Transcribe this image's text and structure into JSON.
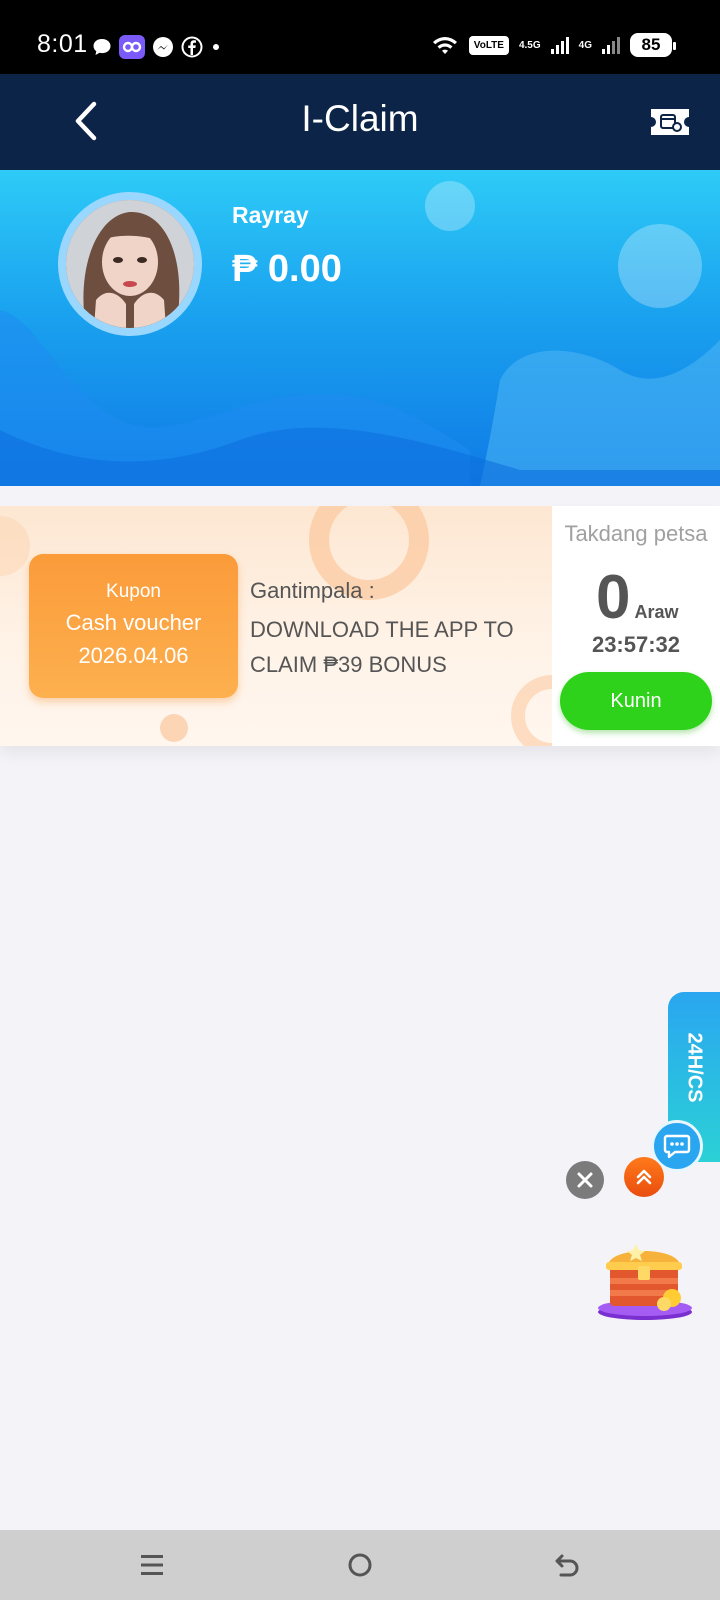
{
  "status_bar": {
    "time": "8:01",
    "network_1": "4.5G",
    "network_2": "4G",
    "volte": "VoLTE",
    "battery": "85"
  },
  "header": {
    "title": "I-Claim",
    "icons": {
      "back": "chevron-left-icon",
      "right": "ticket-icon"
    }
  },
  "profile": {
    "username": "Rayray",
    "balance": "₱ 0.00"
  },
  "coupon": {
    "tag_line1": "Kupon",
    "tag_line2": "Cash voucher",
    "tag_line3": "2026.04.06",
    "reward_label": "Gantimpala :",
    "reward_text": "DOWNLOAD THE APP TO CLAIM ₱39 BONUS",
    "expiry_label": "Takdang petsa",
    "days": "0",
    "days_unit": "Araw",
    "countdown": "23:57:32",
    "claim_label": "Kunin"
  },
  "floating": {
    "cs_label": "24H/CS"
  },
  "colors": {
    "header_bg": "#0b2447",
    "hero_top": "#2ecbf7",
    "hero_bottom": "#0f7ae6",
    "coupon_orange": "#fb9b3a",
    "claim_green": "#2fd21a",
    "cs_blue": "#2aa6f0"
  }
}
